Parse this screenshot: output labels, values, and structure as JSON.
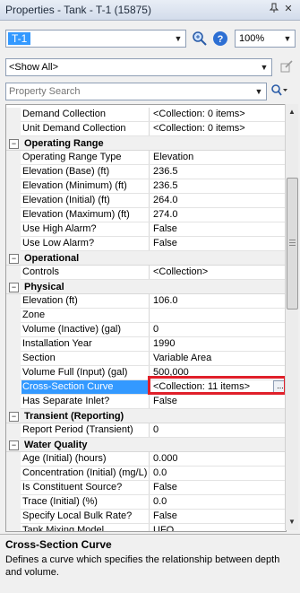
{
  "window": {
    "title": "Properties - Tank - T-1 (15875)",
    "pin_icon": "pin-icon",
    "close_icon": "close-icon"
  },
  "toolbar": {
    "element_value": "T-1",
    "zoom_value": "100%",
    "find_icon": "zoom-find-icon",
    "help_icon": "help-icon"
  },
  "filter": {
    "value": "<Show All>",
    "edit_icon": "edit-icon"
  },
  "search": {
    "placeholder": "Property Search",
    "search_icon": "search-icon"
  },
  "grid": {
    "rows": [
      {
        "kind": "prop",
        "name": "Demand Collection",
        "value": "<Collection: 0 items>"
      },
      {
        "kind": "prop",
        "name": "Unit Demand Collection",
        "value": "<Collection: 0 items>"
      },
      {
        "kind": "cat",
        "name": "Operating Range"
      },
      {
        "kind": "prop",
        "name": "Operating Range Type",
        "value": "Elevation"
      },
      {
        "kind": "prop",
        "name": "Elevation (Base) (ft)",
        "value": "236.5"
      },
      {
        "kind": "prop",
        "name": "Elevation (Minimum) (ft)",
        "value": "236.5"
      },
      {
        "kind": "prop",
        "name": "Elevation (Initial) (ft)",
        "value": "264.0"
      },
      {
        "kind": "prop",
        "name": "Elevation (Maximum) (ft)",
        "value": "274.0"
      },
      {
        "kind": "prop",
        "name": "Use High Alarm?",
        "value": "False"
      },
      {
        "kind": "prop",
        "name": "Use Low Alarm?",
        "value": "False"
      },
      {
        "kind": "cat",
        "name": "Operational"
      },
      {
        "kind": "prop",
        "name": "Controls",
        "value": "<Collection>"
      },
      {
        "kind": "cat",
        "name": "Physical"
      },
      {
        "kind": "prop",
        "name": "Elevation (ft)",
        "value": "106.0"
      },
      {
        "kind": "prop",
        "name": "Zone",
        "value": ""
      },
      {
        "kind": "prop",
        "name": "Volume (Inactive) (gal)",
        "value": "0"
      },
      {
        "kind": "prop",
        "name": "Installation Year",
        "value": "1990"
      },
      {
        "kind": "prop",
        "name": "Section",
        "value": "Variable Area"
      },
      {
        "kind": "prop",
        "name": "Volume Full (Input) (gal)",
        "value": "500,000"
      },
      {
        "kind": "prop",
        "name": "Cross-Section Curve",
        "value": "<Collection: 11 items>",
        "selected": true
      },
      {
        "kind": "prop",
        "name": "Has Separate Inlet?",
        "value": "False"
      },
      {
        "kind": "cat",
        "name": "Transient (Reporting)"
      },
      {
        "kind": "prop",
        "name": "Report Period (Transient)",
        "value": "0"
      },
      {
        "kind": "cat",
        "name": "Water Quality"
      },
      {
        "kind": "prop",
        "name": "Age (Initial) (hours)",
        "value": "0.000"
      },
      {
        "kind": "prop",
        "name": "Concentration (Initial) (mg/L)",
        "value": "0.0"
      },
      {
        "kind": "prop",
        "name": "Is Constituent Source?",
        "value": "False"
      },
      {
        "kind": "prop",
        "name": "Trace (Initial) (%)",
        "value": "0.0"
      },
      {
        "kind": "prop",
        "name": "Specify Local Bulk Rate?",
        "value": "False"
      },
      {
        "kind": "prop",
        "name": "Tank Mixing Model",
        "value": "UFO"
      }
    ],
    "ellipsis_label": "..."
  },
  "description": {
    "title": "Cross-Section Curve",
    "text": "Defines a curve which specifies the relationship between depth and volume."
  },
  "colors": {
    "selection": "#3399ff",
    "highlight": "#e0202a"
  }
}
